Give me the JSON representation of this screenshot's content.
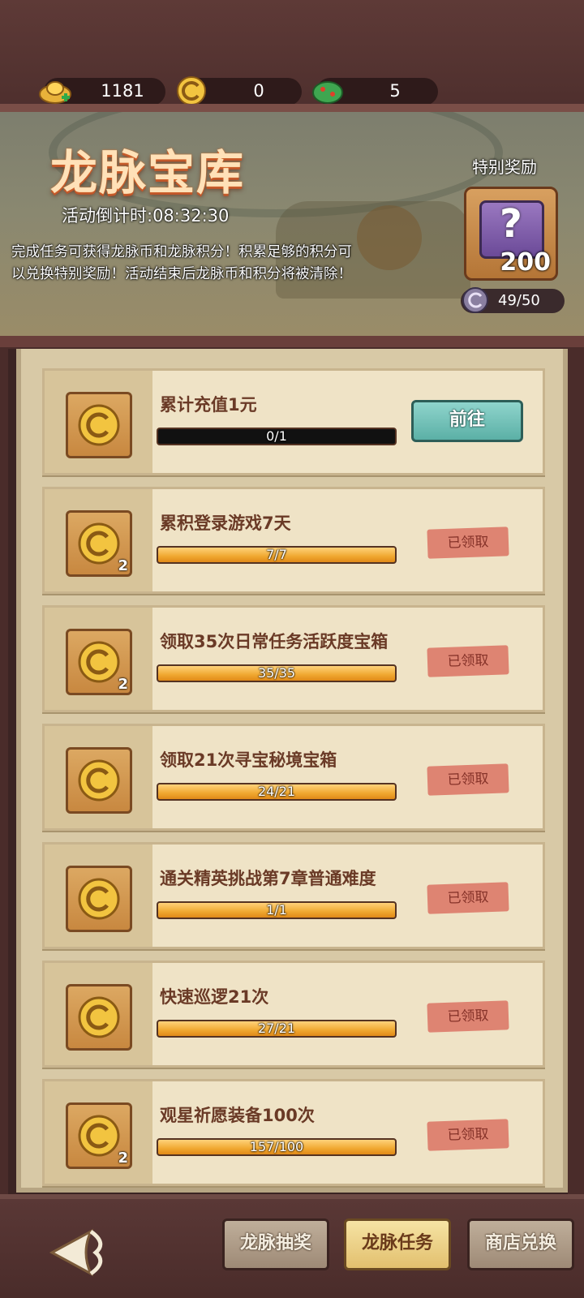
{
  "resources": {
    "gold_ingot": {
      "icon": "gold-ingot-icon",
      "value": "1181"
    },
    "dragon_coin": {
      "icon": "dragon-coin-icon",
      "value": "0"
    },
    "jade_dragon": {
      "icon": "jade-dragon-icon",
      "value": "5"
    }
  },
  "banner": {
    "title": "龙脉宝库",
    "countdown": "活动倒计时:08:32:30",
    "description": "完成任务可获得龙脉币和龙脉积分！积累足够的积分可以兑换特别奖励！活动结束后龙脉币和积分将被清除！",
    "special_reward_label": "特别奖励",
    "special_reward_count": "200",
    "points": "49/50"
  },
  "tasks": [
    {
      "name": "累计充值1元",
      "progress_text": "0/1",
      "progress": 0.0,
      "reward_qty": "",
      "action": "前往",
      "claimed": false
    },
    {
      "name": "累积登录游戏7天",
      "progress_text": "7/7",
      "progress": 1.0,
      "reward_qty": "2",
      "action": "已领取",
      "claimed": true
    },
    {
      "name": "领取35次日常任务活跃度宝箱",
      "progress_text": "35/35",
      "progress": 1.0,
      "reward_qty": "2",
      "action": "已领取",
      "claimed": true
    },
    {
      "name": "领取21次寻宝秘境宝箱",
      "progress_text": "24/21",
      "progress": 1.0,
      "reward_qty": "",
      "action": "已领取",
      "claimed": true
    },
    {
      "name": "通关精英挑战第7章普通难度",
      "progress_text": "1/1",
      "progress": 1.0,
      "reward_qty": "",
      "action": "已领取",
      "claimed": true
    },
    {
      "name": "快速巡逻21次",
      "progress_text": "27/21",
      "progress": 1.0,
      "reward_qty": "",
      "action": "已领取",
      "claimed": true
    },
    {
      "name": "观星祈愿装备100次",
      "progress_text": "157/100",
      "progress": 1.0,
      "reward_qty": "2",
      "action": "已领取",
      "claimed": true
    }
  ],
  "tabs": [
    {
      "label": "龙脉抽奖",
      "active": false
    },
    {
      "label": "龙脉任务",
      "active": true
    },
    {
      "label": "商店兑换",
      "active": false
    }
  ],
  "colors": {
    "background": "#4a2c2a",
    "panel": "#d8c9a6",
    "task_card": "#efe3c6",
    "go_button": "#5bb0a6",
    "claimed_stamp": "#dd7a6a",
    "progress_fill": "#f0a830"
  }
}
